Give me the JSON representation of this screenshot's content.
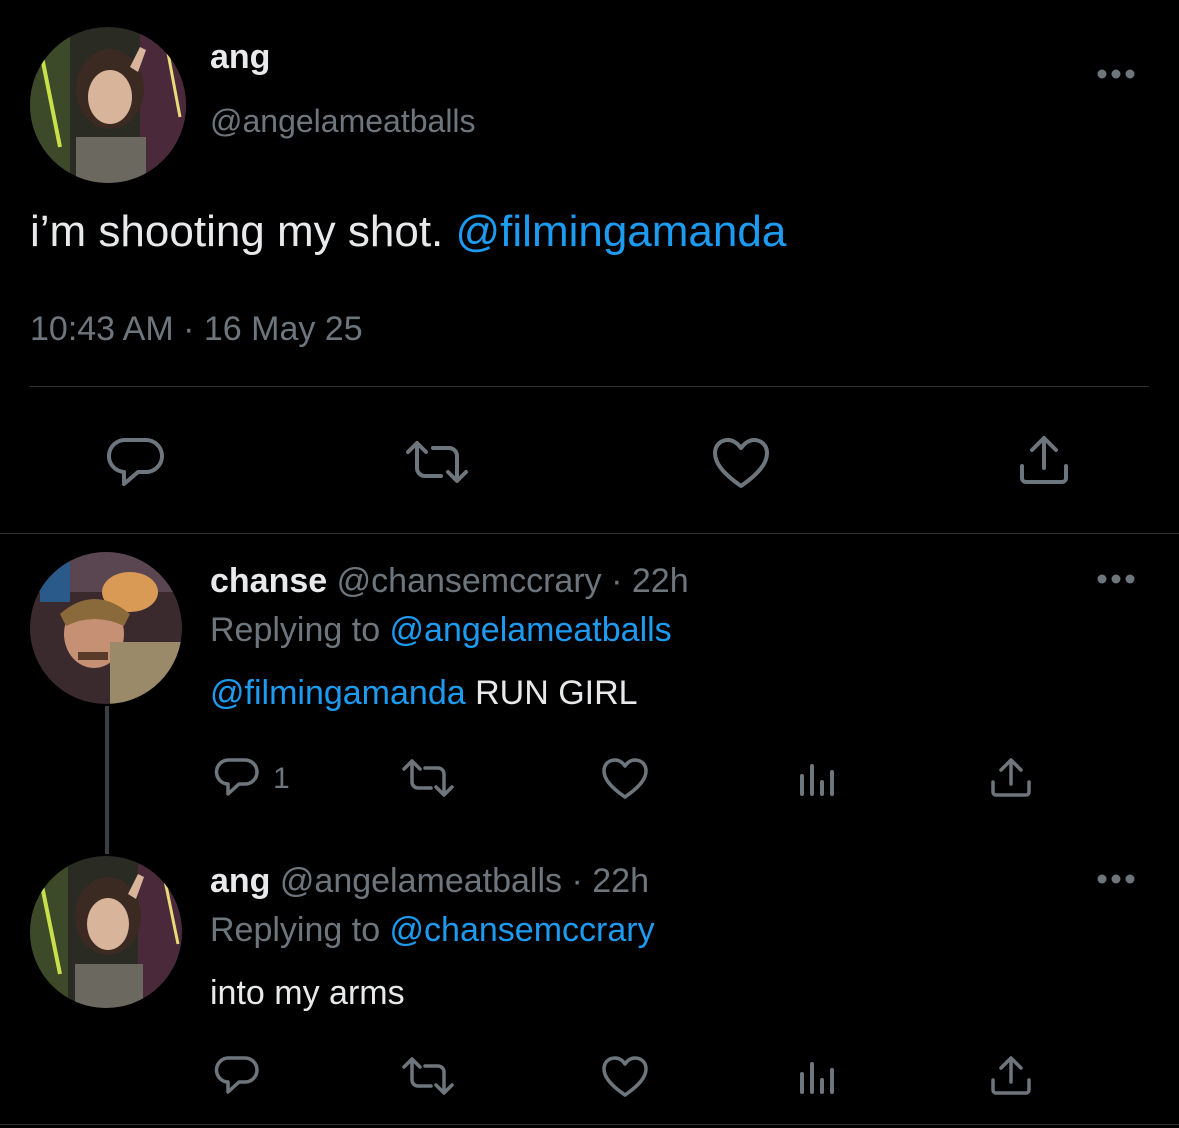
{
  "main_tweet": {
    "name": "ang",
    "handle": "@angelameatballs",
    "text_prefix": "i’m shooting my shot. ",
    "text_mention": "@filmingamanda",
    "timestamp": "10:43 AM · 16 May 25",
    "actions": [
      "reply-icon",
      "retweet-icon",
      "like-icon",
      "share-icon"
    ]
  },
  "replies": [
    {
      "name": "chanse",
      "handle": "@chansemccrary",
      "time": "· 22h",
      "replying_label": "Replying to ",
      "replying_to": "@angelameatballs",
      "text_mention": "@filmingamanda",
      "text": " RUN GIRL",
      "reply_count": "1"
    },
    {
      "name": "ang",
      "handle": "@angelameatballs",
      "time": "· 22h",
      "replying_label": "Replying to ",
      "replying_to": "@chansemccrary",
      "text_mention": "",
      "text": "into my arms",
      "reply_count": ""
    }
  ],
  "colors": {
    "background": "#000000",
    "text": "#e7e9ea",
    "muted": "#6e767d",
    "accent": "#1d9bf0",
    "divider": "#2f3336"
  }
}
